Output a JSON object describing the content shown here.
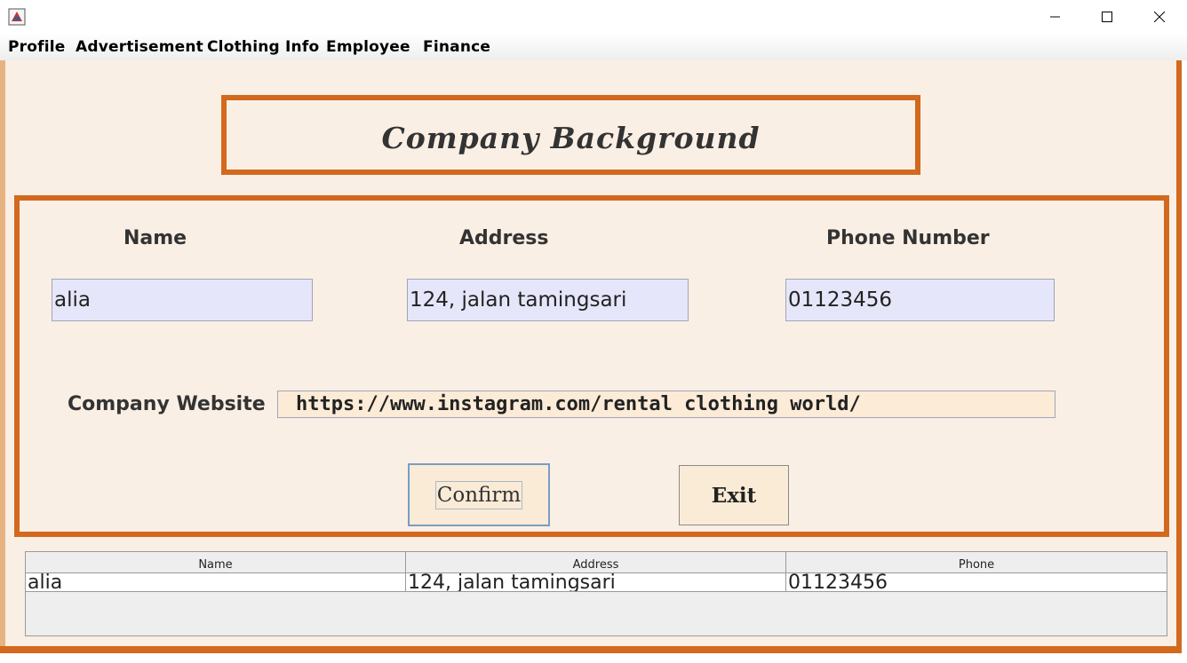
{
  "window": {
    "minimize_icon": "minimize-icon",
    "maximize_icon": "maximize-icon",
    "close_icon": "close-icon"
  },
  "menu": {
    "items": [
      "Profile",
      "Advertisement",
      "Clothing Info",
      "Employee",
      "Finance"
    ]
  },
  "header": {
    "title": "Company Background"
  },
  "form": {
    "name_label": "Name",
    "address_label": "Address",
    "phone_label": "Phone Number",
    "name_value": "alia",
    "address_value": "124, jalan tamingsari",
    "phone_value": "01123456",
    "website_label": "Company Website",
    "website_value": "https://www.instagram.com/rental clothing world/",
    "confirm_label": "Confirm",
    "exit_label": "Exit"
  },
  "table": {
    "columns": [
      "Name",
      "Address",
      "Phone"
    ],
    "rows": [
      [
        "alia",
        "124, jalan tamingsari",
        "01123456"
      ]
    ]
  },
  "colors": {
    "accent": "#d2691e",
    "background": "#faefe4",
    "field": "#e6e6fa"
  }
}
